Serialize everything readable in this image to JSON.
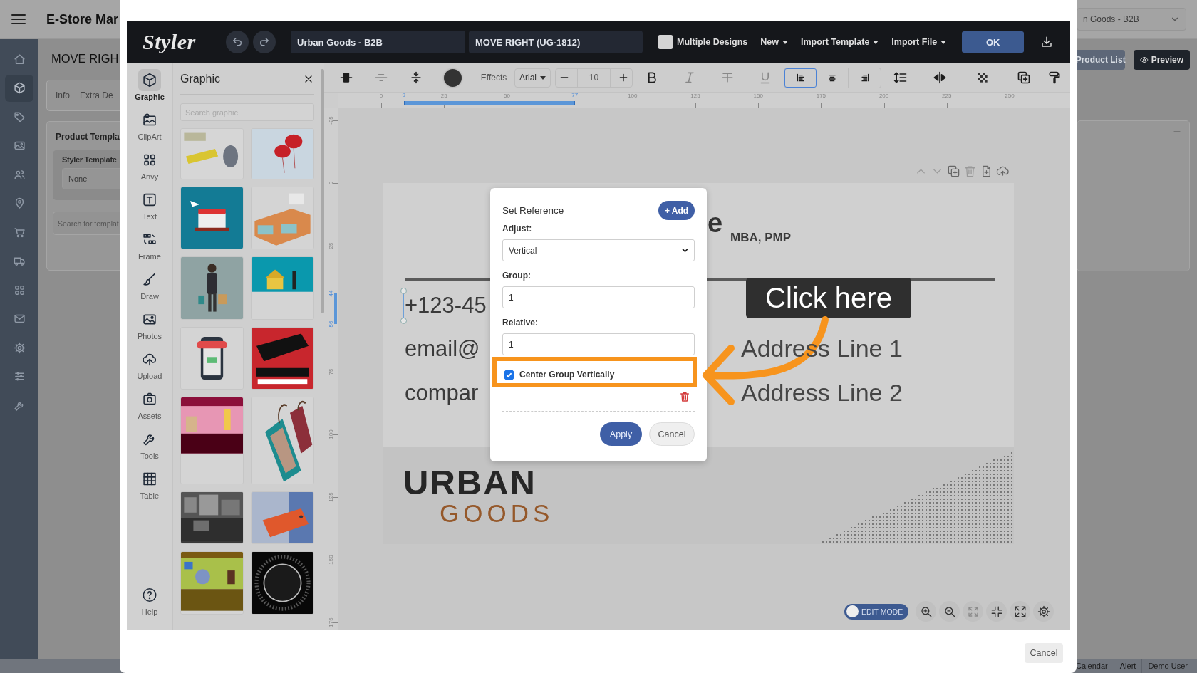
{
  "app_bar": {
    "title": "E-Store Mar",
    "store_select": "n Goods - B2B"
  },
  "sidebar": {
    "items": [
      {
        "selected": false
      },
      {
        "selected": true
      },
      {
        "selected": false
      },
      {
        "selected": false
      },
      {
        "selected": false
      },
      {
        "selected": false
      },
      {
        "selected": false
      },
      {
        "selected": false
      },
      {
        "selected": false
      },
      {
        "selected": false
      },
      {
        "selected": false
      },
      {
        "selected": false
      },
      {
        "selected": false
      }
    ]
  },
  "page": {
    "title": "MOVE RIGH",
    "tabs": [
      "Info",
      "Extra De"
    ],
    "card_title": "Product Templa",
    "field_label": "Styler Template",
    "field_value": "None",
    "search_placeholder": "Search for templat",
    "buttons": [
      "Product List",
      "Preview"
    ]
  },
  "styler": {
    "logo": "Styler",
    "design_set": "Urban Goods - B2B",
    "design_name": "MOVE RIGHT (UG-1812)",
    "multiple_designs": {
      "label": "Multiple Designs",
      "checked": false
    },
    "menus": [
      "New",
      "Import Template",
      "Import File"
    ],
    "ok": "OK"
  },
  "rail": {
    "items": [
      {
        "label": "Graphic",
        "selected": true
      },
      {
        "label": "ClipArt",
        "selected": false
      },
      {
        "label": "Anvy",
        "selected": false
      },
      {
        "label": "Text",
        "selected": false
      },
      {
        "label": "Frame",
        "selected": false
      },
      {
        "label": "Draw",
        "selected": false
      },
      {
        "label": "Photos",
        "selected": false
      },
      {
        "label": "Upload",
        "selected": false
      },
      {
        "label": "Assets",
        "selected": false
      },
      {
        "label": "Tools",
        "selected": false
      },
      {
        "label": "Table",
        "selected": false
      }
    ],
    "help": "Help"
  },
  "graphic_panel": {
    "title": "Graphic",
    "search_placeholder": "Search graphic"
  },
  "toolbar": {
    "effects": "Effects",
    "font": "Arial",
    "font_size": "10",
    "align": [
      {
        "selected": true
      },
      {
        "selected": false
      },
      {
        "selected": false
      }
    ]
  },
  "ruler": {
    "x_ticks": [
      "0",
      "25",
      "50",
      "100",
      "125",
      "150",
      "175",
      "200",
      "225",
      "250"
    ],
    "x_marks": [
      "9",
      "77"
    ],
    "y_ticks": [
      "-25",
      "0",
      "25",
      "75",
      "100",
      "125",
      "150",
      "175"
    ],
    "y_marks": [
      "44",
      "56"
    ]
  },
  "design": {
    "name_end": "e",
    "credentials": "MBA, PMP",
    "phone": "+123-45",
    "email": "email@",
    "company": "compar",
    "address_1": "Address Line 1",
    "address_2": "Address Line 2",
    "logo_top": "URBAN",
    "logo_bottom": "GOODS"
  },
  "reference_dialog": {
    "title": "Set Reference",
    "add": "+ Add",
    "adjust": {
      "label": "Adjust:",
      "value": "Vertical"
    },
    "group": {
      "label": "Group:",
      "value": "1"
    },
    "relative": {
      "label": "Relative:",
      "value": "1"
    },
    "center": {
      "label": "Center Group Vertically",
      "checked": true
    },
    "apply": "Apply",
    "cancel": "Cancel"
  },
  "annotation": {
    "label": "Click here"
  },
  "view_controls": {
    "edit_mode": {
      "label": "EDIT MODE",
      "on": true
    }
  },
  "footer": {
    "cancel": "Cancel"
  },
  "status_bar": [
    "Calendar",
    "Alert",
    "Demo User"
  ]
}
